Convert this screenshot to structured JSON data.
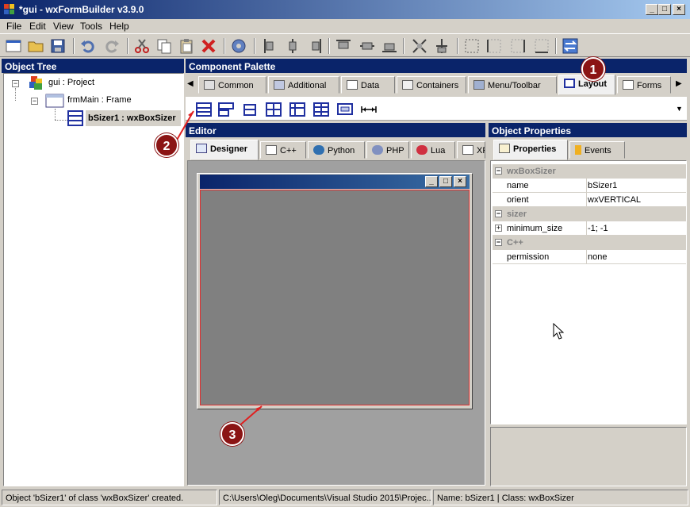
{
  "window": {
    "title": "*gui - wxFormBuilder v3.9.0"
  },
  "menu": [
    "File",
    "Edit",
    "View",
    "Tools",
    "Help"
  ],
  "panels": {
    "object_tree": "Object Tree",
    "palette": "Component Palette",
    "editor": "Editor",
    "properties": "Object Properties"
  },
  "tree": {
    "project": "gui : Project",
    "frame": "frmMain : Frame",
    "sizer": "bSizer1 : wxBoxSizer"
  },
  "palette_tabs": [
    "Common",
    "Additional",
    "Data",
    "Containers",
    "Menu/Toolbar",
    "Layout",
    "Forms"
  ],
  "palette_active": "Layout",
  "editor_tabs": [
    "Designer",
    "C++",
    "Python",
    "PHP",
    "Lua",
    "XR"
  ],
  "props_tabs": [
    "Properties",
    "Events"
  ],
  "props": {
    "cat1": "wxBoxSizer",
    "name_k": "name",
    "name_v": "bSizer1",
    "orient_k": "orient",
    "orient_v": "wxVERTICAL",
    "cat2": "sizer",
    "min_k": "minimum_size",
    "min_v": "-1; -1",
    "cat3": "C++",
    "perm_k": "permission",
    "perm_v": "none"
  },
  "status": {
    "left": "Object 'bSizer1' of class 'wxBoxSizer' created.",
    "mid": "C:\\Users\\Oleg\\Documents\\Visual Studio 2015\\Projec...",
    "right": "Name: bSizer1 | Class: wxBoxSizer"
  },
  "badges": [
    "1",
    "2",
    "3"
  ],
  "colors": {
    "title_blue": "#0a246a",
    "badge_red": "#8b1414",
    "selection_red": "#e03030"
  }
}
